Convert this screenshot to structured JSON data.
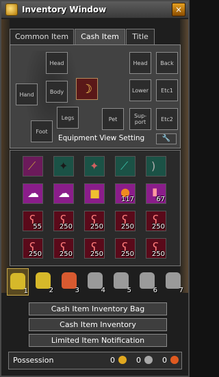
{
  "window": {
    "title": "Inventory Window",
    "close_label": "×"
  },
  "tabs": [
    {
      "label": "Common Item",
      "active": false
    },
    {
      "label": "Cash Item",
      "active": true
    },
    {
      "label": "Title",
      "active": false
    }
  ],
  "equipment": {
    "slots": {
      "head": "Head",
      "body": "Body",
      "hand": "Hand",
      "legs": "Legs",
      "foot": "Foot",
      "head2": "Head",
      "back": "Back",
      "lower": "Lower",
      "etc1": "Etc1",
      "pet": "Pet",
      "support": "Sup-\nport",
      "etc2": "Etc2"
    },
    "view_setting_label": "Equipment View Setting",
    "wrench_icon": "🔧"
  },
  "inventory": {
    "rows": [
      [
        {
          "icon": "scythe",
          "qty": ""
        },
        {
          "icon": "creature-black",
          "qty": ""
        },
        {
          "icon": "creature-green",
          "qty": ""
        },
        {
          "icon": "scythe-teal",
          "qty": ""
        },
        {
          "icon": "bow",
          "qty": ""
        }
      ],
      [
        {
          "icon": "white-cloud",
          "qty": ""
        },
        {
          "icon": "white-cloud-2",
          "qty": ""
        },
        {
          "icon": "gift-box",
          "qty": ""
        },
        {
          "icon": "orange-orb",
          "qty": "117"
        },
        {
          "icon": "potion",
          "qty": "67"
        }
      ],
      [
        {
          "icon": "hook",
          "qty": "55"
        },
        {
          "icon": "hook",
          "qty": "250"
        },
        {
          "icon": "hook",
          "qty": "250"
        },
        {
          "icon": "hook",
          "qty": "250"
        },
        {
          "icon": "hook",
          "qty": "250"
        }
      ],
      [
        {
          "icon": "hook",
          "qty": "250"
        },
        {
          "icon": "hook",
          "qty": "250"
        },
        {
          "icon": "hook",
          "qty": "250"
        },
        {
          "icon": "hook",
          "qty": "250"
        },
        {
          "icon": "hook",
          "qty": "250"
        }
      ]
    ]
  },
  "bags": [
    {
      "num": "1",
      "color": "#d6b82a",
      "active": true
    },
    {
      "num": "2",
      "color": "#d6b82a",
      "active": false
    },
    {
      "num": "3",
      "color": "#d85a30",
      "active": false
    },
    {
      "num": "4",
      "color": "#9a9a9a",
      "active": false
    },
    {
      "num": "5",
      "color": "#9a9a9a",
      "active": false
    },
    {
      "num": "6",
      "color": "#9a9a9a",
      "active": false
    },
    {
      "num": "7",
      "color": "#9a9a9a",
      "active": false
    }
  ],
  "buttons": {
    "bag": "Cash Item Inventory Bag",
    "inventory": "Cash Item Inventory",
    "limited": "Limited Item Notification"
  },
  "possession": {
    "label": "Possession",
    "gold": "0",
    "gold_icon": "G",
    "silver": "0",
    "silver_icon": "S",
    "cash": "0",
    "cash_icon": "C"
  }
}
